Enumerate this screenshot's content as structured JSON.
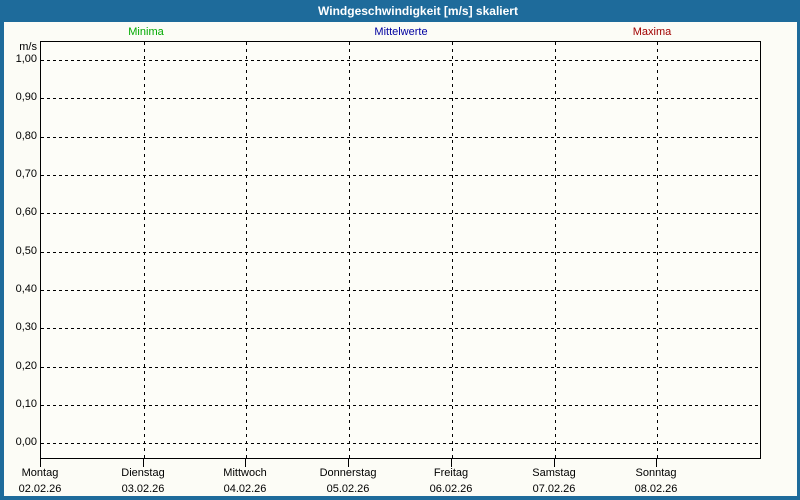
{
  "page": {
    "frame_color": "#1E6B9B",
    "content_bg_color": "#FCFCF6"
  },
  "title_bar": {
    "title": "Windgeschwindigkeit [m/s] skaliert",
    "bg_color": "#1E6B9B",
    "text_color": "#FFFFFF"
  },
  "legend": {
    "items": [
      {
        "label": "Minima",
        "color": "#00AA00"
      },
      {
        "label": "Mittelwerte",
        "color": "#0000A0"
      },
      {
        "label": "Maxima",
        "color": "#A00000"
      }
    ]
  },
  "chart_data": {
    "type": "line",
    "title": "Windgeschwindigkeit [m/s] skaliert",
    "xlabel": "",
    "ylabel": "m/s",
    "ylim": [
      0.0,
      1.0
    ],
    "y_tick_step": 0.1,
    "y_tick_labels": [
      "1,00",
      "0,90",
      "0,80",
      "0,70",
      "0,60",
      "0,50",
      "0,40",
      "0,30",
      "0,20",
      "0,10",
      "0,00"
    ],
    "x_categories_days": [
      "Montag",
      "Dienstag",
      "Mittwoch",
      "Donnerstag",
      "Freitag",
      "Samstag",
      "Sonntag"
    ],
    "x_categories_dates": [
      "02.02.26",
      "03.02.26",
      "04.02.26",
      "05.02.26",
      "06.02.26",
      "07.02.26",
      "08.02.26"
    ],
    "grid": "dashed",
    "legend_position": "top",
    "series": [
      {
        "name": "Minima",
        "color": "#00AA00",
        "values": []
      },
      {
        "name": "Mittelwerte",
        "color": "#0000A0",
        "values": []
      },
      {
        "name": "Maxima",
        "color": "#A00000",
        "values": []
      }
    ],
    "note": "plot area empty - no data drawn"
  }
}
